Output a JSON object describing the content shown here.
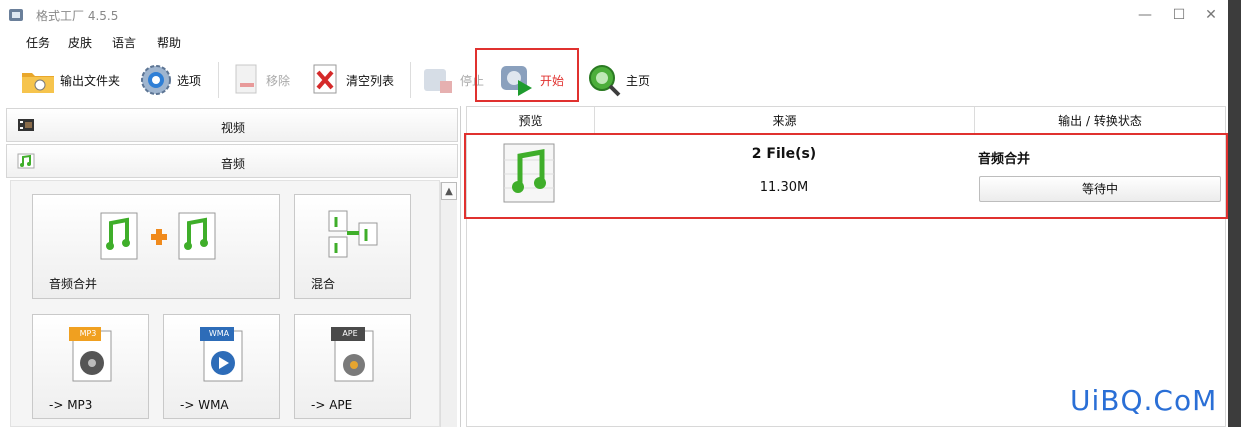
{
  "window": {
    "title": "格式工厂 4.5.5",
    "minimize": "—",
    "maximize": "☐",
    "close": "✕"
  },
  "menu": [
    "任务",
    "皮肤",
    "语言",
    "帮助"
  ],
  "toolbar": {
    "output_folder": "输出文件夹",
    "options": "选项",
    "remove": "移除",
    "clear_list": "清空列表",
    "stop": "停止",
    "start": "开始",
    "home": "主页"
  },
  "categories": {
    "video": "视频",
    "audio": "音频"
  },
  "tiles": [
    "音频合并",
    "混合",
    "-> MP3",
    "-> WMA",
    "-> APE"
  ],
  "tile_badges": {
    "mp3": "MP3",
    "wma": "WMA",
    "ape": "APE"
  },
  "table": {
    "headers": [
      "预览",
      "来源",
      "输出 / 转换状态"
    ],
    "rows": [
      {
        "files": "2 File(s)",
        "size": "11.30M",
        "task": "音频合并",
        "status": "等待中"
      }
    ]
  },
  "watermark": "UiBQ.CoM",
  "colors": {
    "highlight": "#e0312f",
    "watermark": "#2a6fd6",
    "music_green": "#3fae2a"
  }
}
